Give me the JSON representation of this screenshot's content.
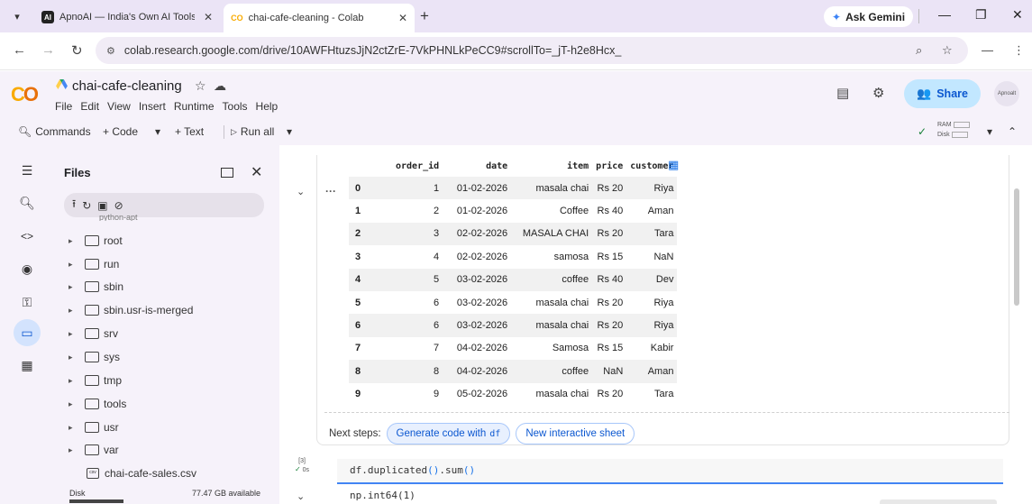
{
  "browser": {
    "tabs": [
      {
        "title": "ApnoAI — India's Own AI Tools",
        "favicon": "AI",
        "active": false
      },
      {
        "title": "chai-cafe-cleaning - Colab",
        "favicon": "CO",
        "active": true
      }
    ],
    "ask_gemini": "Ask Gemini",
    "url": "colab.research.google.com/drive/10AWFHtuzsJjN2ctZrE-7VkPHNLkPeCC9#scrollTo=_jT-h2e8Hcx_"
  },
  "colab": {
    "notebook_title": "chai-cafe-cleaning",
    "menu": [
      "File",
      "Edit",
      "View",
      "Insert",
      "Runtime",
      "Tools",
      "Help"
    ],
    "share_label": "Share",
    "avatar_label": "Apnoalt"
  },
  "toolbar": {
    "commands": "Commands",
    "code": "+ Code",
    "text": "+ Text",
    "run_all": "Run all",
    "ram": "RAM",
    "disk": "Disk"
  },
  "files": {
    "title": "Files",
    "partial_item": "python-apt",
    "folders": [
      "root",
      "run",
      "sbin",
      "sbin.usr-is-merged",
      "srv",
      "sys",
      "tmp",
      "tools",
      "usr",
      "var"
    ],
    "csv_file": "chai-cafe-sales.csv",
    "disk_label": "Disk",
    "disk_available": "77.47 GB available"
  },
  "dataframe": {
    "columns": [
      "order_id",
      "date",
      "item",
      "price",
      "customer"
    ],
    "rows": [
      [
        "0",
        "1",
        "01-02-2026",
        "masala chai",
        "Rs 20",
        "Riya"
      ],
      [
        "1",
        "2",
        "01-02-2026",
        "Coffee",
        "Rs 40",
        "Aman"
      ],
      [
        "2",
        "3",
        "02-02-2026",
        "MASALA CHAI",
        "Rs 20",
        "Tara"
      ],
      [
        "3",
        "4",
        "02-02-2026",
        "samosa",
        "Rs 15",
        "NaN"
      ],
      [
        "4",
        "5",
        "03-02-2026",
        "coffee",
        "Rs 40",
        "Dev"
      ],
      [
        "5",
        "6",
        "03-02-2026",
        "masala chai",
        "Rs 20",
        "Riya"
      ],
      [
        "6",
        "6",
        "03-02-2026",
        "masala chai",
        "Rs 20",
        "Riya"
      ],
      [
        "7",
        "7",
        "04-02-2026",
        "Samosa",
        "Rs 15",
        "Kabir"
      ],
      [
        "8",
        "8",
        "04-02-2026",
        "coffee",
        "NaN",
        "Aman"
      ],
      [
        "9",
        "9",
        "05-02-2026",
        "masala chai",
        "Rs 20",
        "Tara"
      ]
    ]
  },
  "next_steps": {
    "label": "Next steps:",
    "generate": "Generate code with",
    "generate_var": "df",
    "new_sheet": "New interactive sheet"
  },
  "cell2": {
    "exec_count": "[3]",
    "time": "0s",
    "code_fn": "df.duplicated",
    "code_paren1": "()",
    "code_mid": ".sum",
    "code_paren2": "()",
    "output": "np.int64(1)"
  }
}
